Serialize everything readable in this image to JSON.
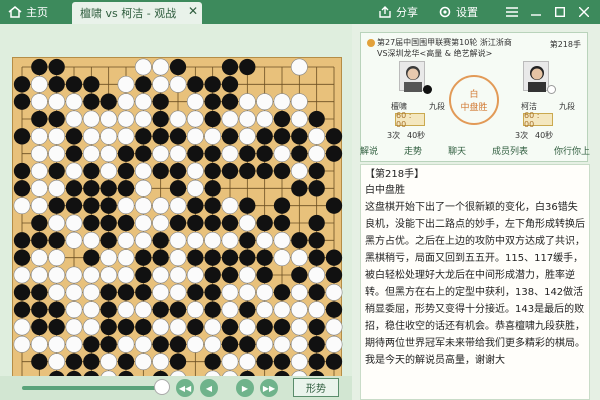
{
  "titlebar": {
    "home_label": "主页",
    "tab_label": "檀啸 vs 柯洁 - 观战",
    "share_label": "分享",
    "settings_label": "设置"
  },
  "match": {
    "title_line1": "第27届中国围甲联赛第10轮 浙江浙商",
    "title_line2": "VS深圳龙华<高量 & 绝艺解说>",
    "move_label": "第218手",
    "result_line1": "白",
    "result_line2": "中盘胜",
    "black": {
      "name": "檀啸",
      "rank": "九段",
      "time": "60 : 00",
      "stat_count": "3次",
      "stat_sec": "40秒"
    },
    "white": {
      "name": "柯洁",
      "rank": "九段",
      "time": "60 : 00",
      "stat_count": "3次",
      "stat_sec": "40秒"
    }
  },
  "tabs": [
    "解说",
    "走势",
    "聊天",
    "成员列表",
    "你行你上"
  ],
  "commentary": {
    "heading": "【第218手】",
    "subheading": "白中盘胜",
    "text": "这盘棋开始下出了一个很新颖的变化，白36错失良机，没能下出二路点的妙手，左下角形成转换后黑方占优。之后在上边的攻防中双方达成了共识，黑棋稍亏，局面又回到五五开。115、117缓手，被白轻松处理好大龙后在中间形成潜力，胜率逆转。但黑方在右上的定型中获利，138、142做活稍显委屈，形势又变得十分接近。143是最后的败招，稳住收空的话还有机会。恭喜檀啸九段获胜，期待两位世界冠军未来带给我们更多精彩的棋局。我是今天的解说员高量，谢谢大"
  },
  "controls": {
    "shape_label": "形势",
    "progress": 0.92
  },
  "board": {
    "size": 19,
    "rows": [
      ".BB....WWB..BB..W..",
      "BWBBB.WBWWBBB......",
      "BWWWBBWWB.WBBWWWW..",
      ".BBWWWWWBWWBWWWBWB.",
      "BWWBWWWBBBWWBWBBBWB",
      ".WWBWWBBWWBBWBBWBWB",
      "BWBWBWBWBBWBBBBBWB.",
      "BWWBBBBW.BWB....BB.",
      "WWBBBBWWWWBBWB.B..B",
      ".BWWBBBWWBBBBWBB.B.",
      "BBBWWBWWBWWWWBWWBB.",
      "BWW.BWWBBWBBBBBWWBB",
      "WWWWWWWBWWWBBWB.BWB",
      "BBWWWBBBWWBBWWWBWBW",
      "BBBWWBWWBBWBWBWWWWB",
      "WBBWWBBBWWBWBWBBWBW",
      "WWWWBBWWBBWWBBWWWBW",
      ".BWBBWBWWB.BWWBBWBB",
      "..BBBWB.BW.WWB.BWB."
    ]
  }
}
